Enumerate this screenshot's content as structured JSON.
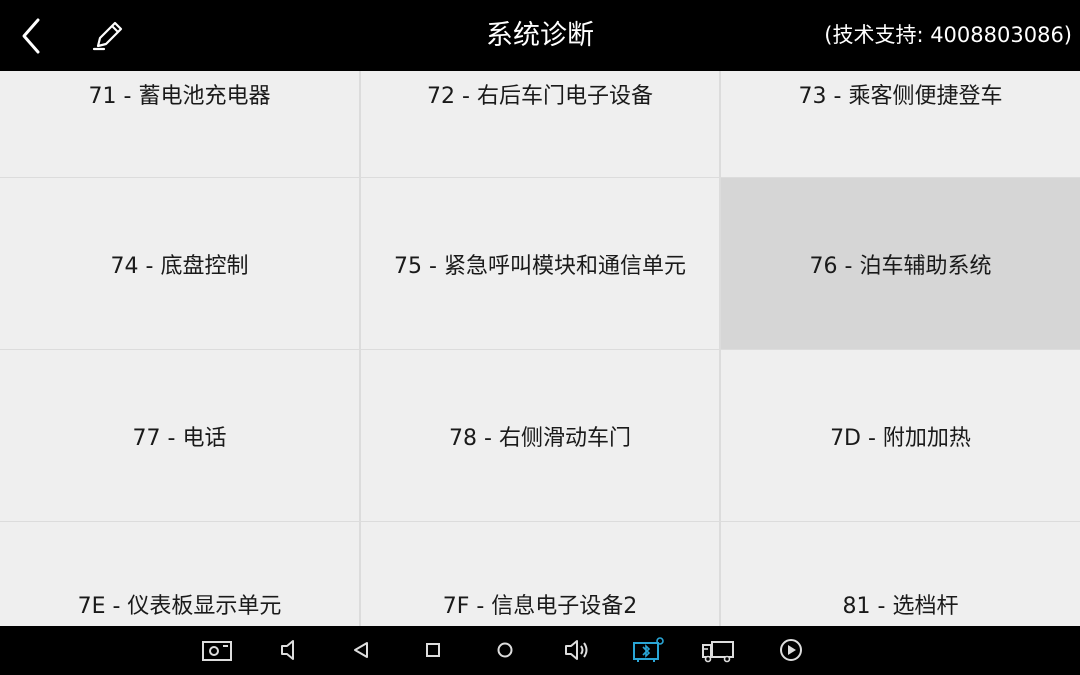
{
  "header": {
    "title": "系统诊断",
    "support": "(技术支持: 4008803086)"
  },
  "items": [
    {
      "label": "71 - 蓄电池充电器"
    },
    {
      "label": "72 - 右后车门电子设备"
    },
    {
      "label": "73 - 乘客侧便捷登车"
    },
    {
      "label": "74 - 底盘控制"
    },
    {
      "label": "75 - 紧急呼叫模块和通信单元"
    },
    {
      "label": "76 - 泊车辅助系统"
    },
    {
      "label": "77 - 电话"
    },
    {
      "label": "78 - 右侧滑动车门"
    },
    {
      "label": "7D - 附加加热"
    },
    {
      "label": "7E - 仪表板显示单元"
    },
    {
      "label": "7F - 信息电子设备2"
    },
    {
      "label": "81 - 选档杆"
    }
  ],
  "selected_item": "76 - 泊车辅助系统",
  "navbar_icons": [
    "screenshot-icon",
    "volume-down-icon",
    "back-icon",
    "recents-icon",
    "home-icon",
    "volume-up-icon",
    "vci-bluetooth-icon",
    "truck-icon",
    "play-icon"
  ],
  "colors": {
    "bar": "#000000",
    "cell": "#efefef",
    "cell_selected": "#d6d6d6",
    "grid_line": "#dcdcdc",
    "accent": "#2aa6d6"
  }
}
